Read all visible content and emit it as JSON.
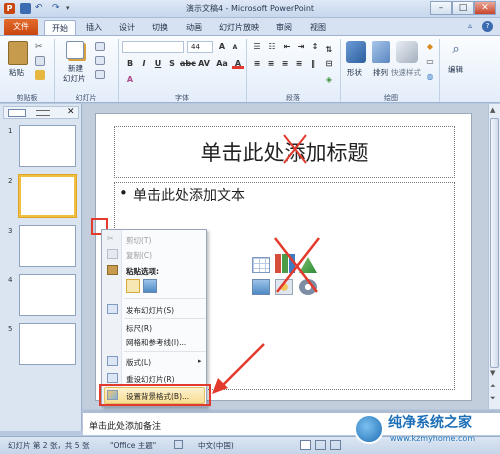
{
  "window": {
    "title": "演示文稿4 - Microsoft PowerPoint",
    "btn_min": "–",
    "btn_max": "□",
    "btn_close": "✕"
  },
  "tabs": [
    "文件",
    "开始",
    "插入",
    "设计",
    "切换",
    "动画",
    "幻灯片放映",
    "审阅",
    "视图"
  ],
  "active_tab": "开始",
  "ribbon": {
    "clipboard": {
      "label": "剪贴板",
      "paste": "粘贴"
    },
    "slides": {
      "label": "幻灯片",
      "new_slide_1": "新建",
      "new_slide_2": "幻灯片"
    },
    "font": {
      "label": "字体",
      "size_value": "44"
    },
    "paragraph": {
      "label": "段落"
    },
    "drawing": {
      "label": "绘图",
      "shapes": "形状",
      "arrange": "排列",
      "quick_styles": "快速样式"
    },
    "editing": {
      "label": "编辑",
      "edit": "编辑"
    }
  },
  "slides_pane": {
    "numbers": [
      "1",
      "2",
      "3",
      "4",
      "5"
    ],
    "selected": "2",
    "close": "✕"
  },
  "slide": {
    "title_placeholder": "单击此处添加标题",
    "content_bullet": "•",
    "content_placeholder": "单击此处添加文本"
  },
  "notes": {
    "placeholder": "单击此处添加备注"
  },
  "context_menu": {
    "items": [
      {
        "label": "剪切(T)",
        "icon": "scissors-icon",
        "disabled": true
      },
      {
        "label": "复制(C)",
        "icon": "copy-icon",
        "disabled": true
      },
      {
        "label": "粘贴选项:",
        "icon": "paste-icon",
        "disabled": false,
        "bold": true
      },
      {
        "label": "发布幻灯片(S)",
        "icon": "publish-icon",
        "disabled": false
      },
      {
        "label": "标尺(R)",
        "icon": "",
        "disabled": false
      },
      {
        "label": "网格和参考线(I)...",
        "icon": "",
        "disabled": false
      },
      {
        "label": "版式(L)",
        "icon": "layout-icon",
        "disabled": false,
        "submenu": true
      },
      {
        "label": "重设幻灯片(R)",
        "icon": "reset-icon",
        "disabled": false
      },
      {
        "label": "设置背景格式(B)...",
        "icon": "background-format-icon",
        "disabled": false
      }
    ],
    "submenu_arrow": "▸"
  },
  "statusbar": {
    "slide_info": "幻灯片 第 2 张，共 5 张",
    "theme": "\"Office 主题\"",
    "language": "中文(中国)"
  },
  "watermark": {
    "brand": "纯净系统之家",
    "url": "www.kzmyhome.com"
  },
  "colors": {
    "file_tab": "#d05a1c",
    "accent": "#2b579a",
    "annotation_red": "#e23a2c",
    "thumb_selected": "#f0c040"
  }
}
